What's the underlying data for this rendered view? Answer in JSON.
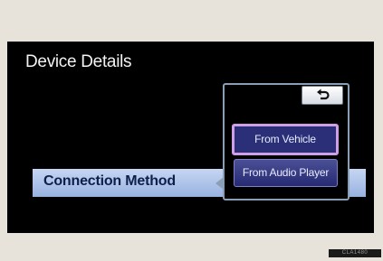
{
  "screen": {
    "title": "Device Details",
    "connection_label": "Connection Method"
  },
  "popup": {
    "back_icon": "back-arrow-icon",
    "options": [
      {
        "label": "From Vehicle",
        "selected": true
      },
      {
        "label": "From Audio Player",
        "selected": false
      }
    ]
  },
  "image_code": "CLA1480",
  "colors": {
    "screen_bg": "#000000",
    "bar": "#b0c4ea",
    "option_bg": "#2a2f78",
    "selected_border": "#cf9fe6"
  }
}
